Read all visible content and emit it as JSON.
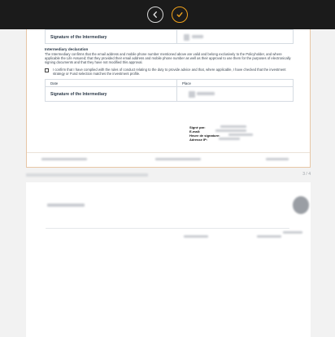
{
  "toolbar": {
    "back_icon": "circle-chevron-left-icon",
    "confirm_icon": "circle-check-icon",
    "accent_color": "#f0a21c"
  },
  "page1": {
    "sig_top_label": "Signature of the Intermediary",
    "declaration_title": "Intermediary declaration",
    "declaration_text": "The Intermediary confirms that the email address and mobile phone number mentioned above are valid and belong exclusively to the Policyholder, and where applicable the Life Assured; that they provided their email address and mobile phone number as well as their approval to use them for the purposes of electronically signing documents and that they have not modified this approval.",
    "confirm_text": "I confirm that I have complied with the rules of conduct relating to the duty to provide advice and that, where applicable, I have checked that the investment strategy or Fund selection matches the investment profile.",
    "date_label": "Date",
    "place_label": "Place",
    "sig_bottom_label": "Signature of the Intermediary",
    "signed_by_label": "Signé par:",
    "email_label": "E-mail:",
    "hour_label": "Heure de signature:",
    "ip_label": "Adresse IP:"
  },
  "page_counter": "3 / 4"
}
